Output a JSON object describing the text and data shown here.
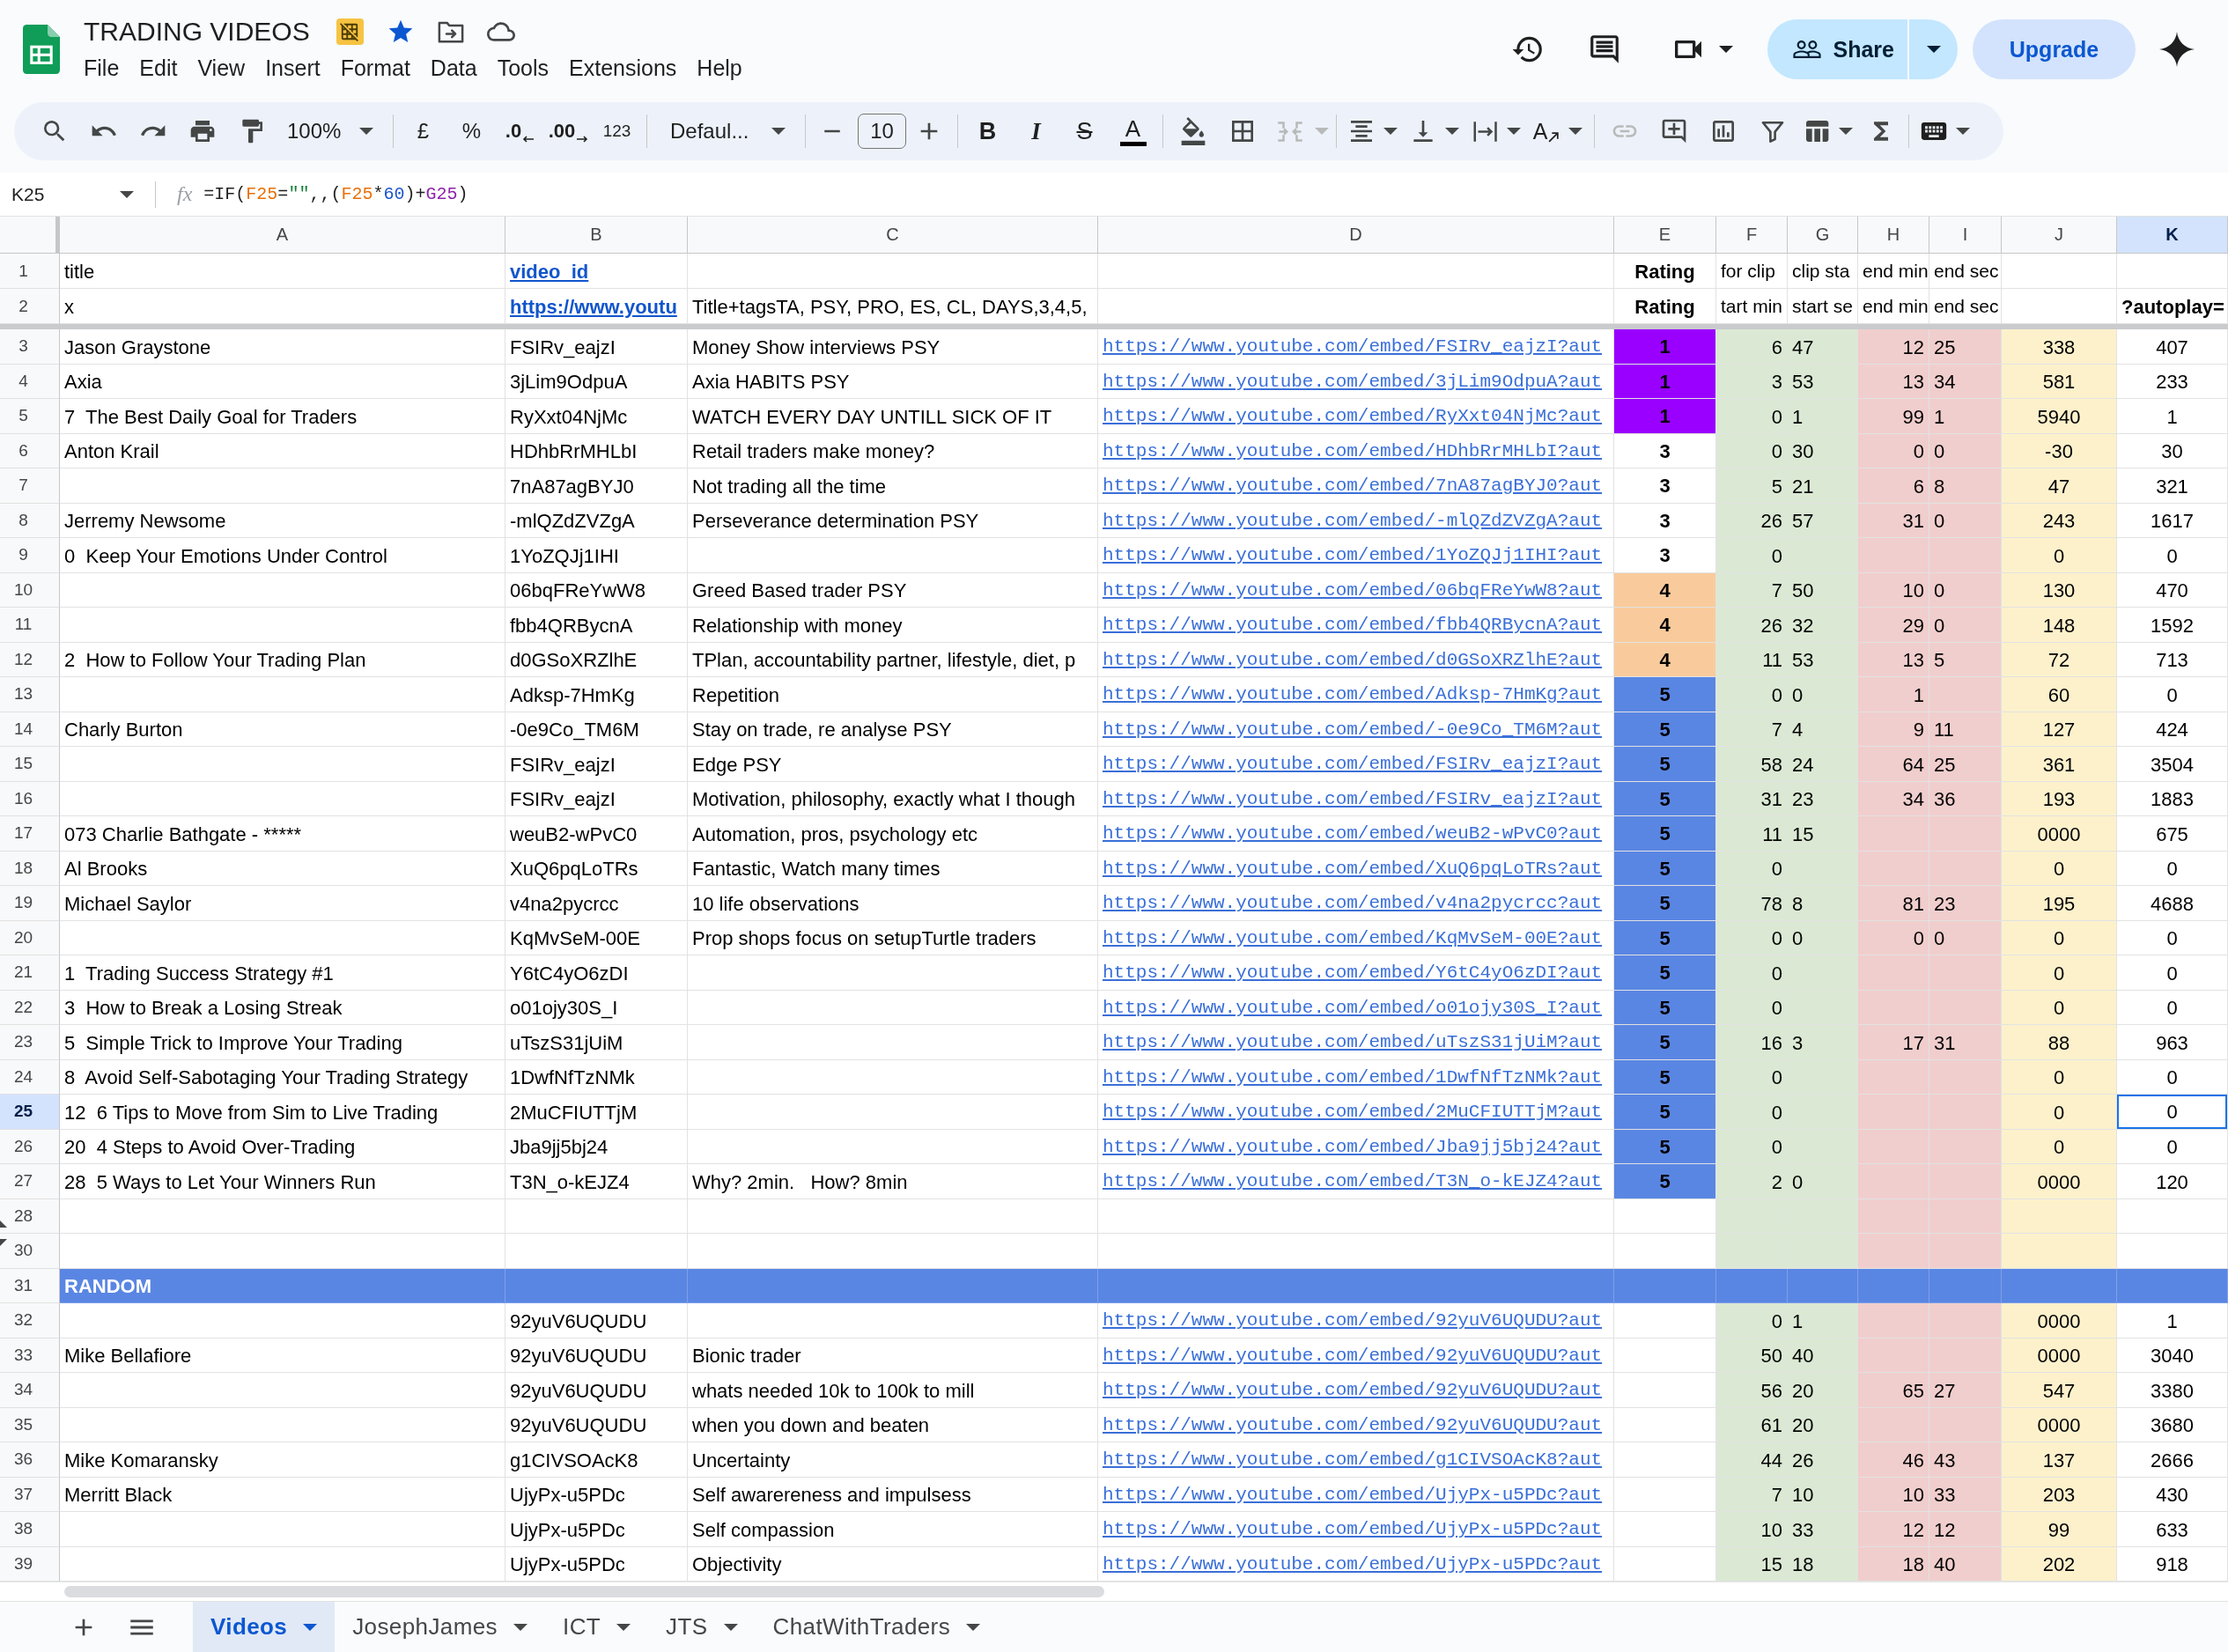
{
  "document": {
    "title": "TRADING VIDEOS",
    "starred": true
  },
  "menu": [
    "File",
    "Edit",
    "View",
    "Insert",
    "Format",
    "Data",
    "Tools",
    "Extensions",
    "Help"
  ],
  "header_actions": {
    "share": "Share",
    "upgrade": "Upgrade"
  },
  "toolbar": {
    "zoom": "100%",
    "currency": "£",
    "percent": "%",
    "decrease_decimal": ".0",
    "increase_decimal": ".00",
    "number_format": "123",
    "font": "Defaul...",
    "font_size": "10",
    "bold": "B",
    "italic": "I",
    "strikethrough": "S",
    "text_color": "A",
    "text_rotation": "A",
    "merge_cells": {
      "disabled": true
    },
    "insert_link": {
      "disabled": true
    }
  },
  "formula_bar": {
    "cell": "K25",
    "fx": "fx",
    "formula": [
      {
        "text": "=IF(",
        "color": "#1f1f1f"
      },
      {
        "text": "F25",
        "color": "#e8710a"
      },
      {
        "text": "=",
        "color": "#1f1f1f"
      },
      {
        "text": "\"\"",
        "color": "#188038"
      },
      {
        "text": ",,(",
        "color": "#1f1f1f"
      },
      {
        "text": "F25",
        "color": "#e8710a"
      },
      {
        "text": "*",
        "color": "#1f1f1f"
      },
      {
        "text": "60",
        "color": "#1a54c9"
      },
      {
        "text": ")+",
        "color": "#1f1f1f"
      },
      {
        "text": "G25",
        "color": "#8e24aa"
      },
      {
        "text": ")",
        "color": "#1f1f1f"
      }
    ]
  },
  "columns": [
    {
      "label": "A",
      "selected": false
    },
    {
      "label": "B",
      "selected": false
    },
    {
      "label": "C",
      "selected": false
    },
    {
      "label": "D",
      "selected": false
    },
    {
      "label": "E",
      "selected": false
    },
    {
      "label": "F",
      "selected": false
    },
    {
      "label": "G",
      "selected": false
    },
    {
      "label": "H",
      "selected": false
    },
    {
      "label": "I",
      "selected": false
    },
    {
      "label": "J",
      "selected": false
    },
    {
      "label": "K",
      "selected": true
    }
  ],
  "rows": [
    {
      "number": "1",
      "selected": false,
      "kind": "header",
      "cells": {
        "A": "title",
        "B": "video_id",
        "E": "Rating",
        "F": "for clip",
        "G": "clip sta",
        "H": "end min",
        "I": "end sec"
      }
    },
    {
      "number": "2",
      "selected": false,
      "kind": "header",
      "cells": {
        "A": "x",
        "B": "https://www.youtu",
        "C": "Title+tagsTA, PSY, PRO, ES, CL, DAYS,3,4,5,",
        "E": "Rating",
        "F": "tart min",
        "G": "start se",
        "H": "end min",
        "I": "end sec",
        "K": "?autoplay="
      }
    },
    {
      "number": "3",
      "selected": false,
      "kind": "data",
      "rating": {
        "value": "1",
        "color": "#9900ff"
      },
      "cells": {
        "A": "Jason Graystone",
        "B": "FSIRv_eajzI",
        "C": "Money Show interviews PSY",
        "D": "https://www.youtube.com/embed/FSIRv_eajzI?aut",
        "F": "6",
        "G": "47",
        "H": "12",
        "I": "25",
        "J": "338",
        "K": "407"
      }
    },
    {
      "number": "4",
      "selected": false,
      "kind": "data",
      "rating": {
        "value": "1",
        "color": "#9900ff"
      },
      "cells": {
        "A": "Axia",
        "B": "3jLim9OdpuA",
        "C": "Axia HABITS PSY",
        "D": "https://www.youtube.com/embed/3jLim9OdpuA?aut",
        "F": "3",
        "G": "53",
        "H": "13",
        "I": "34",
        "J": "581",
        "K": "233"
      }
    },
    {
      "number": "5",
      "selected": false,
      "kind": "data",
      "rating": {
        "value": "1",
        "color": "#9900ff"
      },
      "cells": {
        "A": "7  The Best Daily Goal for Traders",
        "B": "RyXxt04NjMc",
        "C": "WATCH EVERY DAY UNTILL SICK OF IT",
        "D": "https://www.youtube.com/embed/RyXxt04NjMc?aut",
        "F": "0",
        "G": "1",
        "H": "99",
        "I": "1",
        "J": "5940",
        "K": "1"
      }
    },
    {
      "number": "6",
      "selected": false,
      "kind": "data",
      "rating": {
        "value": "3",
        "color": "#ffffff"
      },
      "cells": {
        "A": "Anton Krail",
        "B": "HDhbRrMHLbI",
        "C": "Retail traders make money?",
        "D": "https://www.youtube.com/embed/HDhbRrMHLbI?aut",
        "F": "0",
        "G": "30",
        "H": "0",
        "I": "0",
        "J": "-30",
        "K": "30"
      }
    },
    {
      "number": "7",
      "selected": false,
      "kind": "data",
      "rating": {
        "value": "3",
        "color": "#ffffff"
      },
      "cells": {
        "B": "7nA87agBYJ0",
        "C": "Not trading all the time",
        "D": "https://www.youtube.com/embed/7nA87agBYJ0?aut",
        "F": "5",
        "G": "21",
        "H": "6",
        "I": "8",
        "J": "47",
        "K": "321"
      }
    },
    {
      "number": "8",
      "selected": false,
      "kind": "data",
      "rating": {
        "value": "3",
        "color": "#ffffff"
      },
      "cells": {
        "A": "Jerremy Newsome",
        "B": "-mlQZdZVZgA",
        "C": "Perseverance determination PSY",
        "D": "https://www.youtube.com/embed/-mlQZdZVZgA?aut",
        "F": "26",
        "G": "57",
        "H": "31",
        "I": "0",
        "J": "243",
        "K": "1617"
      }
    },
    {
      "number": "9",
      "selected": false,
      "kind": "data",
      "rating": {
        "value": "3",
        "color": "#ffffff"
      },
      "cells": {
        "A": "0  Keep Your Emotions Under Control",
        "B": "1YoZQJj1IHI",
        "D": "https://www.youtube.com/embed/1YoZQJj1IHI?aut",
        "F": "0",
        "J": "0",
        "K": "0"
      }
    },
    {
      "number": "10",
      "selected": false,
      "kind": "data",
      "rating": {
        "value": "4",
        "color": "#f9cb9c"
      },
      "cells": {
        "B": "06bqFReYwW8",
        "C": "Greed Based trader PSY",
        "D": "https://www.youtube.com/embed/06bqFReYwW8?aut",
        "F": "7",
        "G": "50",
        "H": "10",
        "I": "0",
        "J": "130",
        "K": "470"
      }
    },
    {
      "number": "11",
      "selected": false,
      "kind": "data",
      "rating": {
        "value": "4",
        "color": "#f9cb9c"
      },
      "cells": {
        "B": "fbb4QRBycnA",
        "C": "Relationship with money",
        "D": "https://www.youtube.com/embed/fbb4QRBycnA?aut",
        "F": "26",
        "G": "32",
        "H": "29",
        "I": "0",
        "J": "148",
        "K": "1592"
      }
    },
    {
      "number": "12",
      "selected": false,
      "kind": "data",
      "rating": {
        "value": "4",
        "color": "#f9cb9c"
      },
      "cells": {
        "A": "2  How to Follow Your Trading Plan",
        "B": "d0GSoXRZlhE",
        "C": "TPlan, accountability partner, lifestyle, diet, p",
        "D": "https://www.youtube.com/embed/d0GSoXRZlhE?aut",
        "F": "11",
        "G": "53",
        "H": "13",
        "I": "5",
        "J": "72",
        "K": "713"
      }
    },
    {
      "number": "13",
      "selected": false,
      "kind": "data",
      "rating": {
        "value": "5",
        "color": "#5a86e3"
      },
      "cells": {
        "B": "Adksp-7HmKg",
        "C": "Repetition",
        "D": "https://www.youtube.com/embed/Adksp-7HmKg?aut",
        "F": "0",
        "G": "0",
        "H": "1",
        "J": "60",
        "K": "0"
      }
    },
    {
      "number": "14",
      "selected": false,
      "kind": "data",
      "rating": {
        "value": "5",
        "color": "#5a86e3"
      },
      "cells": {
        "A": "Charly Burton",
        "B": "-0e9Co_TM6M",
        "C": "Stay on trade, re analyse PSY",
        "D": "https://www.youtube.com/embed/-0e9Co_TM6M?aut",
        "F": "7",
        "G": "4",
        "H": "9",
        "I": "11",
        "J": "127",
        "K": "424"
      }
    },
    {
      "number": "15",
      "selected": false,
      "kind": "data",
      "rating": {
        "value": "5",
        "color": "#5a86e3"
      },
      "cells": {
        "B": "FSIRv_eajzI",
        "C": "Edge PSY",
        "D": "https://www.youtube.com/embed/FSIRv_eajzI?aut",
        "F": "58",
        "G": "24",
        "H": "64",
        "I": "25",
        "J": "361",
        "K": "3504"
      }
    },
    {
      "number": "16",
      "selected": false,
      "kind": "data",
      "rating": {
        "value": "5",
        "color": "#5a86e3"
      },
      "cells": {
        "B": "FSIRv_eajzI",
        "C": "Motivation, philosophy, exactly what I though",
        "D": "https://www.youtube.com/embed/FSIRv_eajzI?aut",
        "F": "31",
        "G": "23",
        "H": "34",
        "I": "36",
        "J": "193",
        "K": "1883"
      }
    },
    {
      "number": "17",
      "selected": false,
      "kind": "data",
      "rating": {
        "value": "5",
        "color": "#5a86e3"
      },
      "cells": {
        "A": "073 Charlie Bathgate - *****",
        "B": "weuB2-wPvC0",
        "C": "Automation, pros, psychology etc",
        "D": "https://www.youtube.com/embed/weuB2-wPvC0?aut",
        "F": "11",
        "G": "15",
        "J": "0000",
        "K": "675"
      }
    },
    {
      "number": "18",
      "selected": false,
      "kind": "data",
      "rating": {
        "value": "5",
        "color": "#5a86e3"
      },
      "cells": {
        "A": "Al Brooks",
        "B": "XuQ6pqLoTRs",
        "C": "Fantastic, Watch many times",
        "D": "https://www.youtube.com/embed/XuQ6pqLoTRs?aut",
        "F": "0",
        "J": "0",
        "K": "0"
      }
    },
    {
      "number": "19",
      "selected": false,
      "kind": "data",
      "rating": {
        "value": "5",
        "color": "#5a86e3"
      },
      "cells": {
        "A": "Michael Saylor",
        "B": "v4na2pycrcc",
        "C": "10 life observations",
        "D": "https://www.youtube.com/embed/v4na2pycrcc?aut",
        "F": "78",
        "G": "8",
        "H": "81",
        "I": "23",
        "J": "195",
        "K": "4688"
      }
    },
    {
      "number": "20",
      "selected": false,
      "kind": "data",
      "rating": {
        "value": "5",
        "color": "#5a86e3"
      },
      "cells": {
        "B": "KqMvSeM-00E",
        "C": "Prop shops focus on setupTurtle traders",
        "D": "https://www.youtube.com/embed/KqMvSeM-00E?aut",
        "F": "0",
        "G": "0",
        "H": "0",
        "I": "0",
        "J": "0",
        "K": "0"
      }
    },
    {
      "number": "21",
      "selected": false,
      "kind": "data",
      "rating": {
        "value": "5",
        "color": "#5a86e3"
      },
      "cells": {
        "A": "1  Trading Success Strategy #1",
        "B": "Y6tC4yO6zDI",
        "D": "https://www.youtube.com/embed/Y6tC4yO6zDI?aut",
        "F": "0",
        "J": "0",
        "K": "0"
      }
    },
    {
      "number": "22",
      "selected": false,
      "kind": "data",
      "rating": {
        "value": "5",
        "color": "#5a86e3"
      },
      "cells": {
        "A": "3  How to Break a Losing Streak",
        "B": "o01ojy30S_I",
        "D": "https://www.youtube.com/embed/o01ojy30S_I?aut",
        "F": "0",
        "J": "0",
        "K": "0"
      }
    },
    {
      "number": "23",
      "selected": false,
      "kind": "data",
      "rating": {
        "value": "5",
        "color": "#5a86e3"
      },
      "cells": {
        "A": "5  Simple Trick to Improve Your Trading",
        "B": "uTszS31jUiM",
        "D": "https://www.youtube.com/embed/uTszS31jUiM?aut",
        "F": "16",
        "G": "3",
        "H": "17",
        "I": "31",
        "J": "88",
        "K": "963"
      }
    },
    {
      "number": "24",
      "selected": false,
      "kind": "data",
      "rating": {
        "value": "5",
        "color": "#5a86e3"
      },
      "cells": {
        "A": "8  Avoid Self-Sabotaging Your Trading Strategy",
        "B": "1DwfNfTzNMk",
        "D": "https://www.youtube.com/embed/1DwfNfTzNMk?aut",
        "F": "0",
        "J": "0",
        "K": "0"
      }
    },
    {
      "number": "25",
      "selected": true,
      "kind": "data",
      "rating": {
        "value": "5",
        "color": "#5a86e3"
      },
      "cells": {
        "A": "12  6 Tips to Move from Sim to Live Trading",
        "B": "2MuCFIUTTjM",
        "D": "https://www.youtube.com/embed/2MuCFIUTTjM?aut",
        "F": "0",
        "J": "0",
        "K": "0"
      }
    },
    {
      "number": "26",
      "selected": false,
      "kind": "data",
      "rating": {
        "value": "5",
        "color": "#5a86e3"
      },
      "cells": {
        "A": "20  4 Steps to Avoid Over-Trading",
        "B": "Jba9jj5bj24",
        "D": "https://www.youtube.com/embed/Jba9jj5bj24?aut",
        "F": "0",
        "J": "0",
        "K": "0"
      }
    },
    {
      "number": "27",
      "selected": false,
      "kind": "data",
      "rating": {
        "value": "5",
        "color": "#5a86e3"
      },
      "cells": {
        "A": "28  5 Ways to Let Your Winners Run",
        "B": "T3N_o-kEJZ4",
        "C": "Why? 2min.   How? 8min",
        "D": "https://www.youtube.com/embed/T3N_o-kEJZ4?aut",
        "F": "2",
        "G": "0",
        "J": "0000",
        "K": "120"
      }
    },
    {
      "number": "28",
      "selected": false,
      "kind": "blank",
      "hidden_row_below": true
    },
    {
      "number": "30",
      "selected": false,
      "kind": "blank",
      "hidden_row_above": true
    },
    {
      "number": "31",
      "selected": false,
      "kind": "section",
      "cells": {
        "A": "RANDOM"
      }
    },
    {
      "number": "32",
      "selected": false,
      "kind": "data",
      "cells": {
        "B": "92yuV6UQUDU",
        "D": "https://www.youtube.com/embed/92yuV6UQUDU?aut",
        "F": "0",
        "G": "1",
        "J": "0000",
        "K": "1"
      }
    },
    {
      "number": "33",
      "selected": false,
      "kind": "data",
      "cells": {
        "A": "Mike Bellafiore",
        "B": "92yuV6UQUDU",
        "C": "Bionic trader",
        "D": "https://www.youtube.com/embed/92yuV6UQUDU?aut",
        "F": "50",
        "G": "40",
        "J": "0000",
        "K": "3040"
      }
    },
    {
      "number": "34",
      "selected": false,
      "kind": "data",
      "cells": {
        "B": "92yuV6UQUDU",
        "C": "whats needed 10k to 100k to mill",
        "D": "https://www.youtube.com/embed/92yuV6UQUDU?aut",
        "F": "56",
        "G": "20",
        "H": "65",
        "I": "27",
        "J": "547",
        "K": "3380"
      }
    },
    {
      "number": "35",
      "selected": false,
      "kind": "data",
      "cells": {
        "B": "92yuV6UQUDU",
        "C": "when you down and beaten",
        "D": "https://www.youtube.com/embed/92yuV6UQUDU?aut",
        "F": "61",
        "G": "20",
        "J": "0000",
        "K": "3680"
      }
    },
    {
      "number": "36",
      "selected": false,
      "kind": "data",
      "cells": {
        "A": "Mike Komaransky",
        "B": "g1CIVSOAcK8",
        "C": "Uncertainty",
        "D": "https://www.youtube.com/embed/g1CIVSOAcK8?aut",
        "F": "44",
        "G": "26",
        "H": "46",
        "I": "43",
        "J": "137",
        "K": "2666"
      }
    },
    {
      "number": "37",
      "selected": false,
      "kind": "data",
      "cells": {
        "A": "Merritt Black",
        "B": "UjyPx-u5PDc",
        "C": "Self awarereness and impulsess",
        "D": "https://www.youtube.com/embed/UjyPx-u5PDc?aut",
        "F": "7",
        "G": "10",
        "H": "10",
        "I": "33",
        "J": "203",
        "K": "430"
      }
    },
    {
      "number": "38",
      "selected": false,
      "kind": "data",
      "cells": {
        "B": "UjyPx-u5PDc",
        "C": "Self compassion",
        "D": "https://www.youtube.com/embed/UjyPx-u5PDc?aut",
        "F": "10",
        "G": "33",
        "H": "12",
        "I": "12",
        "J": "99",
        "K": "633"
      }
    },
    {
      "number": "39",
      "selected": false,
      "kind": "data",
      "cells": {
        "B": "UjyPx-u5PDc",
        "C": "Objectivity",
        "D": "https://www.youtube.com/embed/UjyPx-u5PDc?aut",
        "F": "15",
        "G": "18",
        "H": "18",
        "I": "40",
        "J": "202",
        "K": "918"
      }
    }
  ],
  "sheet_tabs": [
    {
      "label": "Videos",
      "selected": true
    },
    {
      "label": "JosephJames",
      "selected": false
    },
    {
      "label": "ICT",
      "selected": false
    },
    {
      "label": "JTS",
      "selected": false
    },
    {
      "label": "ChatWithTraders",
      "selected": false
    }
  ]
}
